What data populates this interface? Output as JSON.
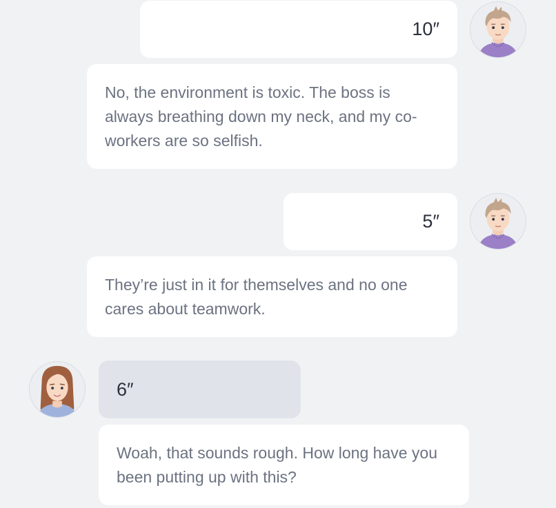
{
  "conversation": {
    "messages": [
      {
        "type": "voice",
        "duration": "10″",
        "speaker": "male"
      },
      {
        "type": "text",
        "text": "No, the environment is toxic. The boss is always breathing down my neck, and my co-workers are so selfish.",
        "speaker": "male"
      },
      {
        "type": "voice",
        "duration": "5″",
        "speaker": "male"
      },
      {
        "type": "text",
        "text": "They’re just in it for themselves and no one cares about teamwork.",
        "speaker": "male"
      },
      {
        "type": "voice",
        "duration": "6″",
        "speaker": "female"
      },
      {
        "type": "text",
        "text": "Woah, that sounds rough. How long have you been putting up with this?",
        "speaker": "female"
      }
    ]
  },
  "avatars": {
    "male": {
      "icon": "male-avatar-icon"
    },
    "female": {
      "icon": "female-avatar-icon"
    }
  },
  "colors": {
    "background": "#f1f2f4",
    "bubble": "#ffffff",
    "bubble_highlight": "#e0e4ea"
  }
}
